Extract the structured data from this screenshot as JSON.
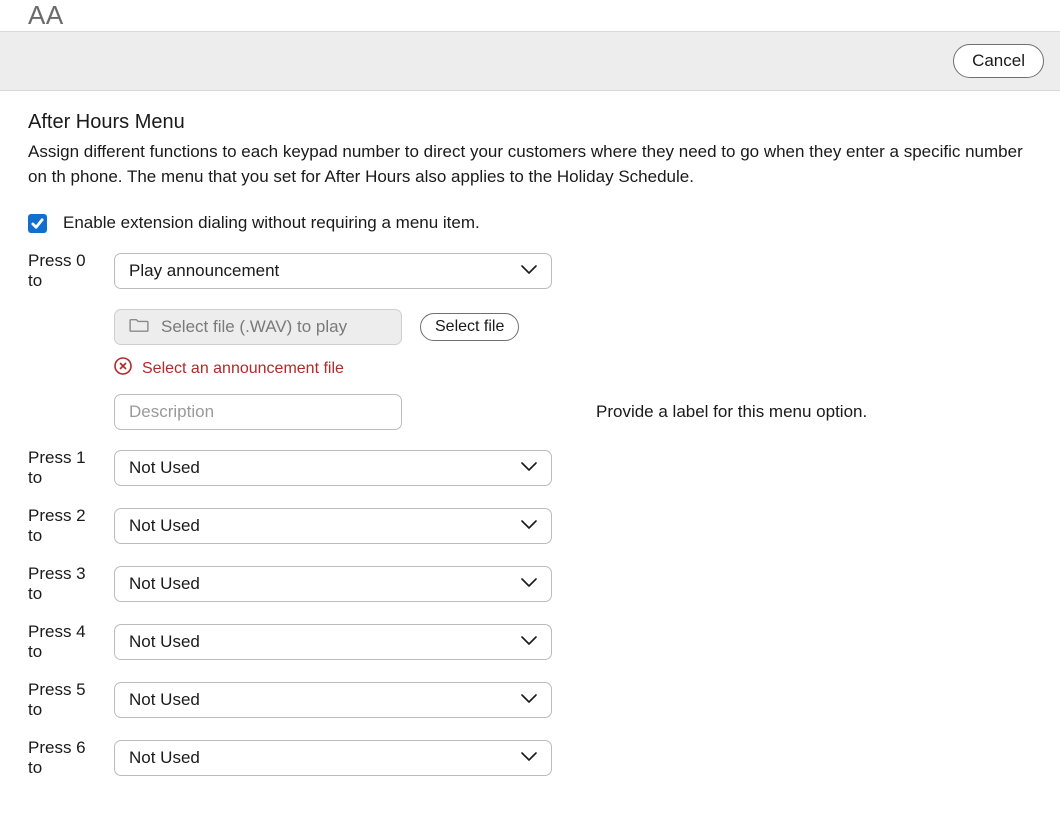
{
  "header": {
    "app_title": "AA"
  },
  "actions": {
    "cancel_label": "Cancel"
  },
  "section": {
    "title": "After Hours Menu",
    "description": "Assign different functions to each keypad number to direct your customers where they need to go when they enter a specific number on th phone. The menu that you set for After Hours also applies to the Holiday Schedule."
  },
  "enable_ext": {
    "label": "Enable extension dialing without requiring a menu item.",
    "checked": true
  },
  "press0": {
    "label": "Press 0 to",
    "selected": "Play announcement",
    "file_placeholder": "Select file (.WAV) to play",
    "select_file_label": "Select file",
    "error_text": "Select an announcement file",
    "description_placeholder": "Description",
    "hint": "Provide a label for this menu option."
  },
  "rows": [
    {
      "label": "Press 1 to",
      "selected": "Not Used"
    },
    {
      "label": "Press 2 to",
      "selected": "Not Used"
    },
    {
      "label": "Press 3 to",
      "selected": "Not Used"
    },
    {
      "label": "Press 4 to",
      "selected": "Not Used"
    },
    {
      "label": "Press 5 to",
      "selected": "Not Used"
    },
    {
      "label": "Press 6 to",
      "selected": "Not Used"
    }
  ]
}
